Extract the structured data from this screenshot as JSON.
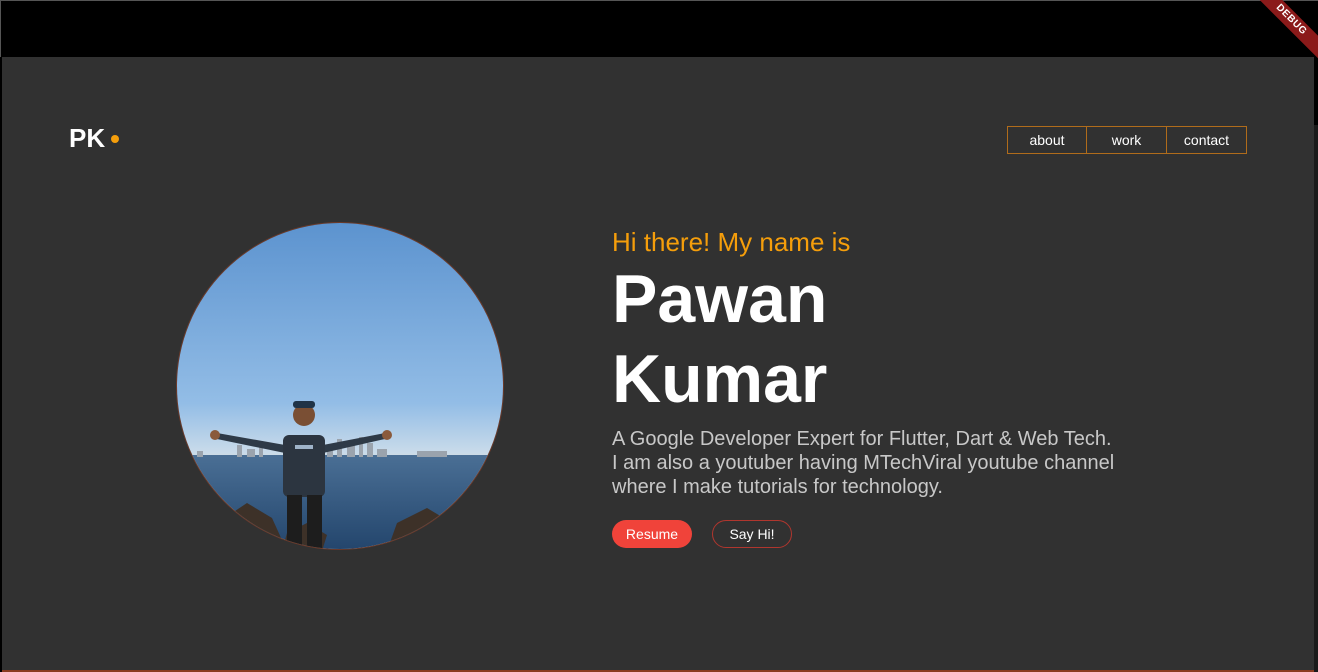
{
  "debug_banner": "DEBUG",
  "header": {
    "logo_text": "PK",
    "nav": [
      {
        "label": "about"
      },
      {
        "label": "work"
      },
      {
        "label": "contact"
      }
    ]
  },
  "hero": {
    "greeting": "Hi there! My name is",
    "name_line1": "Pawan",
    "name_line2": "Kumar",
    "bio_line1": "A Google Developer Expert for Flutter, Dart & Web Tech.",
    "bio_line2": "I am also a youtuber having MTechViral youtube channel",
    "bio_line3": "where I make tutorials for technology.",
    "resume_label": "Resume",
    "sayhi_label": "Say Hi!"
  },
  "colors": {
    "background": "#313131",
    "accent": "#f59e0b",
    "primary_button": "#f0433a",
    "nav_border": "#b06c1b"
  }
}
